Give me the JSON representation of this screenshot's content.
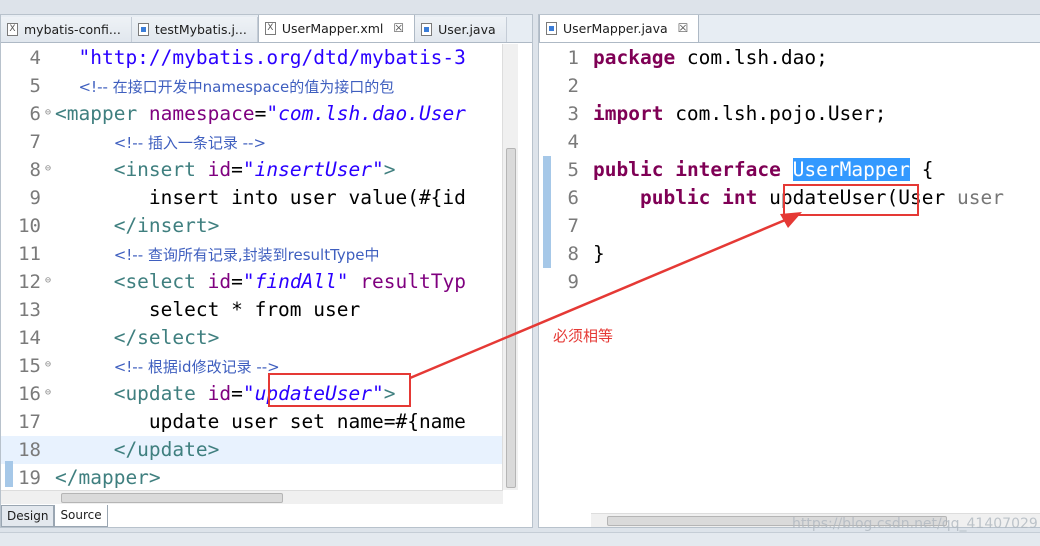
{
  "left_editor": {
    "tabs": [
      {
        "label": "mybatis-confi...",
        "icon": "xml-file-icon"
      },
      {
        "label": "testMybatis.j...",
        "icon": "java-file-icon"
      },
      {
        "label": "UserMapper.xml",
        "icon": "xml-file-icon",
        "active": true
      },
      {
        "label": "User.java",
        "icon": "java-file-icon"
      }
    ],
    "lines": [
      {
        "n": "4",
        "tokens": [
          {
            "t": "  ",
            "c": "plain"
          },
          {
            "t": "\"http://mybatis.org/dtd/mybatis-3",
            "c": "str"
          }
        ]
      },
      {
        "n": "5",
        "tokens": [
          {
            "t": "  ",
            "c": "plain"
          },
          {
            "t": "<!-- 在接口开发中namespace的值为接口的包",
            "c": "cmt"
          }
        ]
      },
      {
        "n": "6",
        "fold": true,
        "tokens": [
          {
            "t": "<mapper ",
            "c": "tag"
          },
          {
            "t": "namespace",
            "c": "attr"
          },
          {
            "t": "=",
            "c": "plain"
          },
          {
            "t": "\"com.lsh.dao.User",
            "c": "val"
          }
        ]
      },
      {
        "n": "7",
        "tokens": [
          {
            "t": "     ",
            "c": "plain"
          },
          {
            "t": "<!-- 插入一条记录 -->",
            "c": "cmt"
          }
        ]
      },
      {
        "n": "8",
        "fold": true,
        "tokens": [
          {
            "t": "     ",
            "c": "plain"
          },
          {
            "t": "<insert ",
            "c": "tag"
          },
          {
            "t": "id",
            "c": "attr"
          },
          {
            "t": "=",
            "c": "plain"
          },
          {
            "t": "\"insertUser\"",
            "c": "val"
          },
          {
            "t": ">",
            "c": "tag"
          }
        ]
      },
      {
        "n": "9",
        "tokens": [
          {
            "t": "        insert into user value(#{id",
            "c": "plain"
          }
        ]
      },
      {
        "n": "10",
        "tokens": [
          {
            "t": "     ",
            "c": "plain"
          },
          {
            "t": "</insert>",
            "c": "tag"
          }
        ]
      },
      {
        "n": "11",
        "tokens": [
          {
            "t": "     ",
            "c": "plain"
          },
          {
            "t": "<!-- 查询所有记录,封装到resultType中",
            "c": "cmt"
          }
        ]
      },
      {
        "n": "12",
        "fold": true,
        "tokens": [
          {
            "t": "     ",
            "c": "plain"
          },
          {
            "t": "<select ",
            "c": "tag"
          },
          {
            "t": "id",
            "c": "attr"
          },
          {
            "t": "=",
            "c": "plain"
          },
          {
            "t": "\"findAll\"",
            "c": "val"
          },
          {
            "t": " resultTyp",
            "c": "attr"
          }
        ]
      },
      {
        "n": "13",
        "tokens": [
          {
            "t": "        select * from user",
            "c": "plain"
          }
        ]
      },
      {
        "n": "14",
        "tokens": [
          {
            "t": "     ",
            "c": "plain"
          },
          {
            "t": "</select>",
            "c": "tag"
          }
        ]
      },
      {
        "n": "15",
        "fold": true,
        "tokens": [
          {
            "t": "     ",
            "c": "plain"
          },
          {
            "t": "<!-- 根据id修改记录 -->",
            "c": "cmt"
          }
        ]
      },
      {
        "n": "16",
        "fold": true,
        "tokens": [
          {
            "t": "     ",
            "c": "plain"
          },
          {
            "t": "<update ",
            "c": "tag"
          },
          {
            "t": "id",
            "c": "attr"
          },
          {
            "t": "=",
            "c": "plain"
          },
          {
            "t": "\"updateUser\"",
            "c": "val"
          },
          {
            "t": ">",
            "c": "tag"
          }
        ]
      },
      {
        "n": "17",
        "tokens": [
          {
            "t": "        update user set name=#{name",
            "c": "plain"
          }
        ]
      },
      {
        "n": "18",
        "current": true,
        "tokens": [
          {
            "t": "     ",
            "c": "plain"
          },
          {
            "t": "</update>",
            "c": "tag"
          }
        ]
      },
      {
        "n": "19",
        "tokens": [
          {
            "t": "</mapper>",
            "c": "tag"
          }
        ]
      }
    ],
    "bottom_tabs": [
      "Design",
      "Source"
    ]
  },
  "right_editor": {
    "tabs": [
      {
        "label": "UserMapper.java",
        "icon": "java-file-icon",
        "active": true
      }
    ],
    "lines": [
      {
        "n": "1",
        "tokens": [
          {
            "t": "package",
            "c": "kw"
          },
          {
            "t": " com.lsh.dao;",
            "c": "plain"
          }
        ]
      },
      {
        "n": "2",
        "tokens": []
      },
      {
        "n": "3",
        "tokens": [
          {
            "t": "import",
            "c": "kw"
          },
          {
            "t": " com.lsh.pojo.User;",
            "c": "plain"
          }
        ]
      },
      {
        "n": "4",
        "tokens": []
      },
      {
        "n": "5",
        "tokens": [
          {
            "t": "public",
            "c": "kw"
          },
          {
            "t": " ",
            "c": "plain"
          },
          {
            "t": "interface",
            "c": "kw"
          },
          {
            "t": " ",
            "c": "plain"
          },
          {
            "t": "UserMapper",
            "c": "sel"
          },
          {
            "t": " {",
            "c": "plain"
          }
        ]
      },
      {
        "n": "6",
        "tokens": [
          {
            "t": "    ",
            "c": "plain"
          },
          {
            "t": "public",
            "c": "kw"
          },
          {
            "t": " ",
            "c": "plain"
          },
          {
            "t": "int",
            "c": "kw"
          },
          {
            "t": " updateUser(User ",
            "c": "plain"
          },
          {
            "t": "user",
            "c": "gray"
          }
        ]
      },
      {
        "n": "7",
        "tokens": []
      },
      {
        "n": "8",
        "tokens": [
          {
            "t": "}",
            "c": "plain"
          }
        ]
      },
      {
        "n": "9",
        "tokens": []
      }
    ]
  },
  "annotation": {
    "text": "必须相等"
  },
  "watermark": {
    "text": "https://blog.csdn.net/qq_41407029"
  }
}
